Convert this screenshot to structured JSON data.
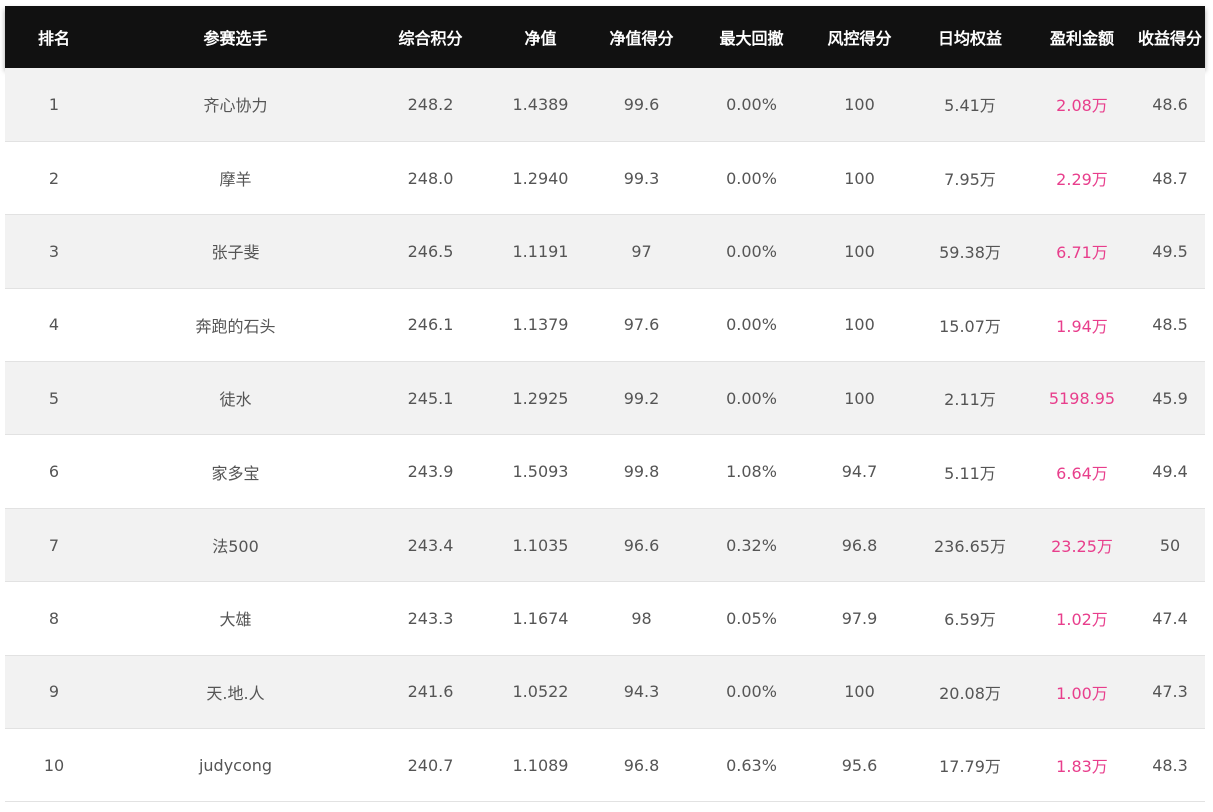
{
  "headers": [
    "排名",
    "参赛选手",
    "综合积分",
    "净值",
    "净值得分",
    "最大回撤",
    "风控得分",
    "日均权益",
    "盈利金额",
    "收益得分"
  ],
  "rows": [
    {
      "rank": "1",
      "name": "齐心协力",
      "score": "248.2",
      "nav": "1.4389",
      "nav_score": "99.6",
      "max_drawdown": "0.00%",
      "risk_score": "100",
      "avg_equity": "5.41万",
      "profit": "2.08万",
      "return_score": "48.6"
    },
    {
      "rank": "2",
      "name": "摩羊",
      "score": "248.0",
      "nav": "1.2940",
      "nav_score": "99.3",
      "max_drawdown": "0.00%",
      "risk_score": "100",
      "avg_equity": "7.95万",
      "profit": "2.29万",
      "return_score": "48.7"
    },
    {
      "rank": "3",
      "name": "张子斐",
      "score": "246.5",
      "nav": "1.1191",
      "nav_score": "97",
      "max_drawdown": "0.00%",
      "risk_score": "100",
      "avg_equity": "59.38万",
      "profit": "6.71万",
      "return_score": "49.5"
    },
    {
      "rank": "4",
      "name": "奔跑的石头",
      "score": "246.1",
      "nav": "1.1379",
      "nav_score": "97.6",
      "max_drawdown": "0.00%",
      "risk_score": "100",
      "avg_equity": "15.07万",
      "profit": "1.94万",
      "return_score": "48.5"
    },
    {
      "rank": "5",
      "name": "徒水",
      "score": "245.1",
      "nav": "1.2925",
      "nav_score": "99.2",
      "max_drawdown": "0.00%",
      "risk_score": "100",
      "avg_equity": "2.11万",
      "profit": "5198.95",
      "return_score": "45.9"
    },
    {
      "rank": "6",
      "name": "家多宝",
      "score": "243.9",
      "nav": "1.5093",
      "nav_score": "99.8",
      "max_drawdown": "1.08%",
      "risk_score": "94.7",
      "avg_equity": "5.11万",
      "profit": "6.64万",
      "return_score": "49.4"
    },
    {
      "rank": "7",
      "name": "法500",
      "score": "243.4",
      "nav": "1.1035",
      "nav_score": "96.6",
      "max_drawdown": "0.32%",
      "risk_score": "96.8",
      "avg_equity": "236.65万",
      "profit": "23.25万",
      "return_score": "50"
    },
    {
      "rank": "8",
      "name": "大雄",
      "score": "243.3",
      "nav": "1.1674",
      "nav_score": "98",
      "max_drawdown": "0.05%",
      "risk_score": "97.9",
      "avg_equity": "6.59万",
      "profit": "1.02万",
      "return_score": "47.4"
    },
    {
      "rank": "9",
      "name": "天.地.人",
      "score": "241.6",
      "nav": "1.0522",
      "nav_score": "94.3",
      "max_drawdown": "0.00%",
      "risk_score": "100",
      "avg_equity": "20.08万",
      "profit": "1.00万",
      "return_score": "47.3"
    },
    {
      "rank": "10",
      "name": "judycong",
      "score": "240.7",
      "nav": "1.1089",
      "nav_score": "96.8",
      "max_drawdown": "0.63%",
      "risk_score": "95.6",
      "avg_equity": "17.79万",
      "profit": "1.83万",
      "return_score": "48.3"
    }
  ],
  "colors": {
    "header_bg": "#111111",
    "header_text": "#ffffff",
    "row_odd": "#f2f2f2",
    "row_even": "#ffffff",
    "cell_text": "#555555",
    "profit_text": "#e83e8c"
  }
}
